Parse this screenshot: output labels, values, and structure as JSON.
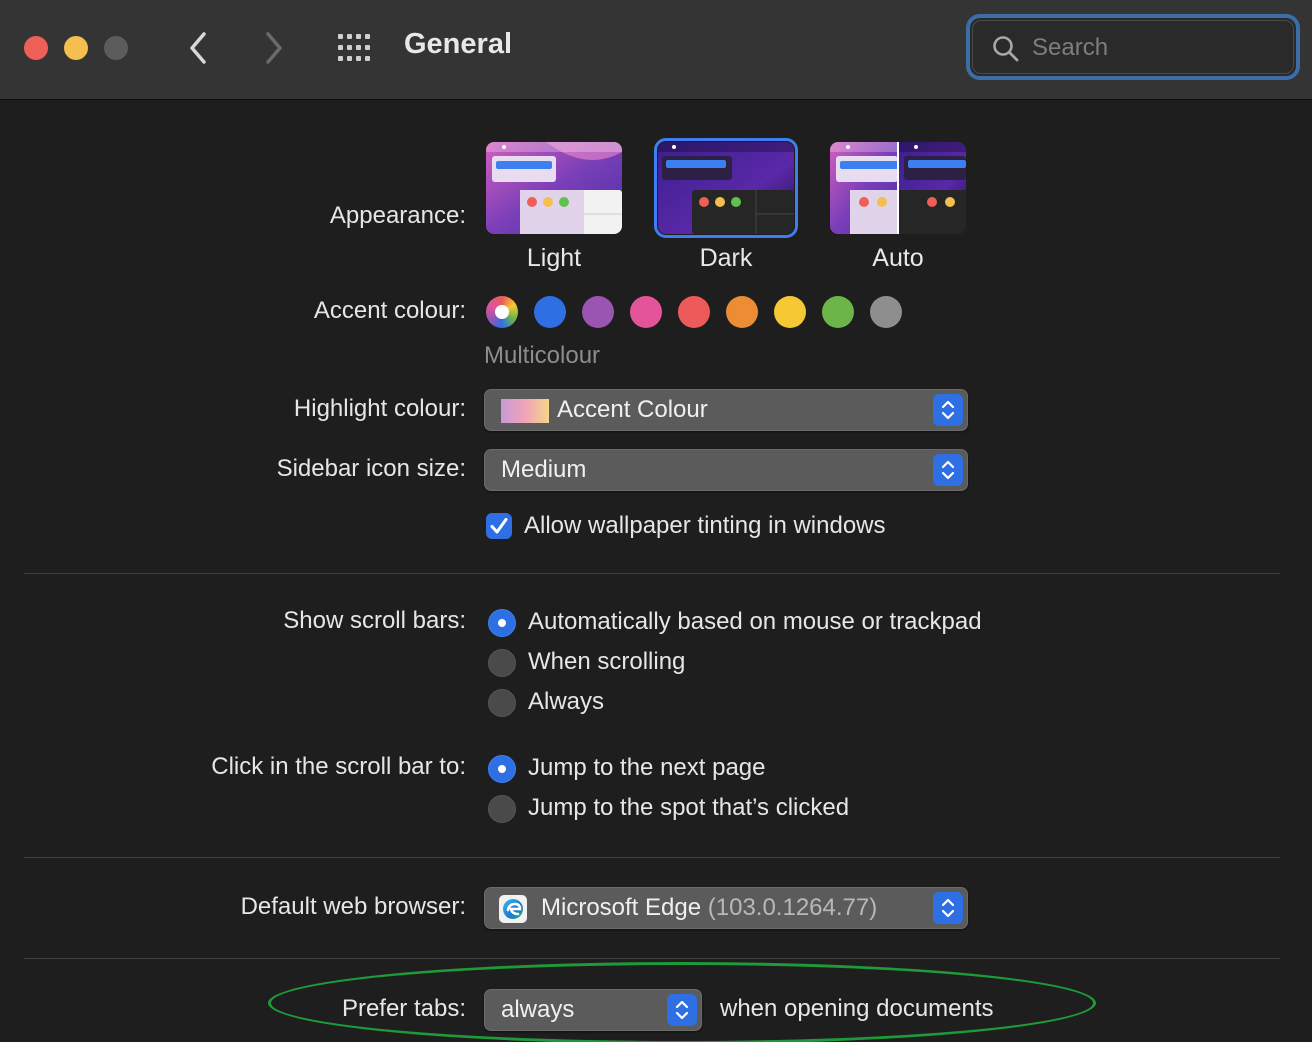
{
  "window": {
    "title": "General",
    "search_placeholder": "Search"
  },
  "appearance": {
    "label": "Appearance:",
    "options": [
      {
        "name": "Light",
        "selected": false
      },
      {
        "name": "Dark",
        "selected": true
      },
      {
        "name": "Auto",
        "selected": false
      }
    ]
  },
  "accent": {
    "label": "Accent colour:",
    "selected_name": "Multicolour",
    "swatches": [
      {
        "name": "multicolour",
        "color": "#ffffff"
      },
      {
        "name": "blue",
        "color": "#2f6fe4"
      },
      {
        "name": "purple",
        "color": "#9a55b3"
      },
      {
        "name": "pink",
        "color": "#e4549a"
      },
      {
        "name": "red",
        "color": "#ec5b5a"
      },
      {
        "name": "orange",
        "color": "#ec8c34"
      },
      {
        "name": "yellow",
        "color": "#f5c834"
      },
      {
        "name": "green",
        "color": "#6cb548"
      },
      {
        "name": "graphite",
        "color": "#8e8e8e"
      }
    ]
  },
  "highlight": {
    "label": "Highlight colour:",
    "value": "Accent Colour"
  },
  "sidebar_icon_size": {
    "label": "Sidebar icon size:",
    "value": "Medium"
  },
  "wallpaper_tinting": {
    "label": "Allow wallpaper tinting in windows",
    "checked": true
  },
  "scroll_bars": {
    "label": "Show scroll bars:",
    "options": [
      {
        "label": "Automatically based on mouse or trackpad",
        "selected": true
      },
      {
        "label": "When scrolling",
        "selected": false
      },
      {
        "label": "Always",
        "selected": false
      }
    ]
  },
  "scroll_click": {
    "label": "Click in the scroll bar to:",
    "options": [
      {
        "label": "Jump to the next page",
        "selected": true
      },
      {
        "label": "Jump to the spot that’s clicked",
        "selected": false
      }
    ]
  },
  "default_browser": {
    "label": "Default web browser:",
    "name": "Microsoft Edge",
    "version": "(103.0.1264.77)"
  },
  "prefer_tabs": {
    "label": "Prefer tabs:",
    "value": "always",
    "suffix": "when opening documents"
  },
  "colors": {
    "accent": "#2f6fe4",
    "annotation": "#1e9b39"
  }
}
